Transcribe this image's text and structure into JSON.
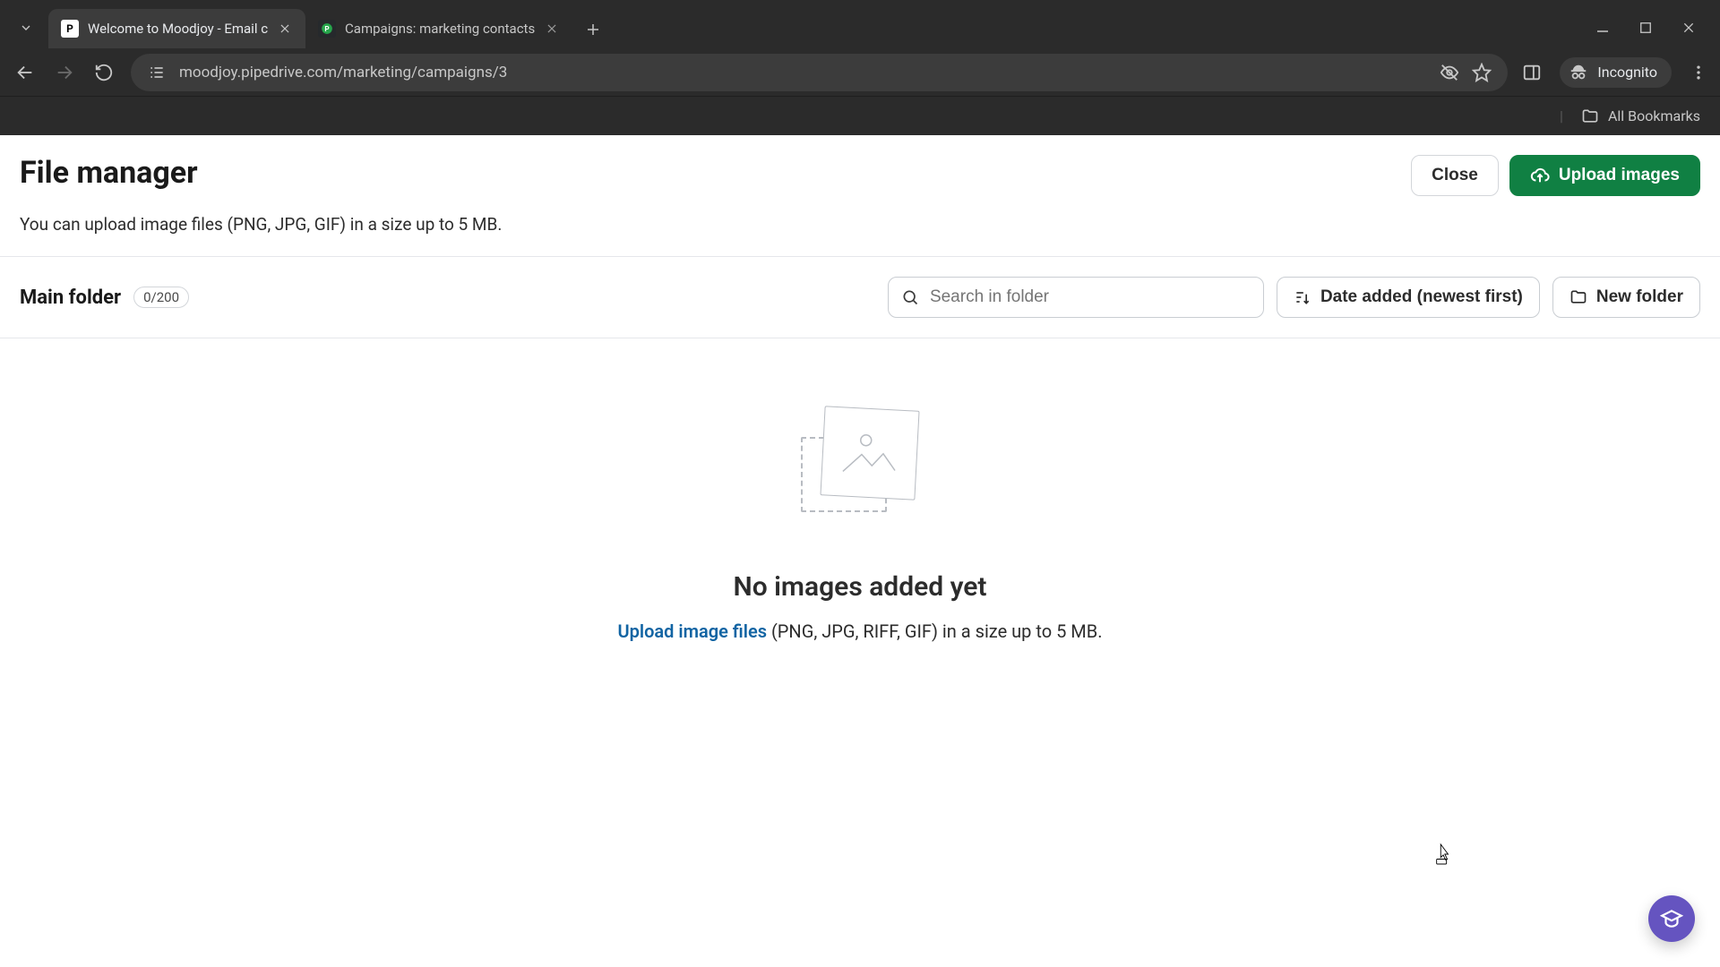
{
  "browser": {
    "tabs": [
      {
        "title": "Welcome to Moodjoy - Email c",
        "active": true
      },
      {
        "title": "Campaigns: marketing contacts",
        "active": false
      }
    ],
    "url_display": "moodjoy.pipedrive.com/marketing/campaigns/3",
    "incognito_label": "Incognito",
    "all_bookmarks": "All Bookmarks"
  },
  "header": {
    "title": "File manager",
    "close": "Close",
    "upload": "Upload images",
    "subtitle": "You can upload image files (PNG, JPG, GIF) in a size up to 5 MB."
  },
  "folder": {
    "name": "Main folder",
    "count": "0/200",
    "search_placeholder": "Search in folder",
    "sort_label": "Date added (newest first)",
    "new_folder": "New folder"
  },
  "empty": {
    "title": "No images added yet",
    "upload_link": "Upload image files",
    "rest": " (PNG, JPG, RIFF, GIF) in a size up to 5 MB."
  }
}
